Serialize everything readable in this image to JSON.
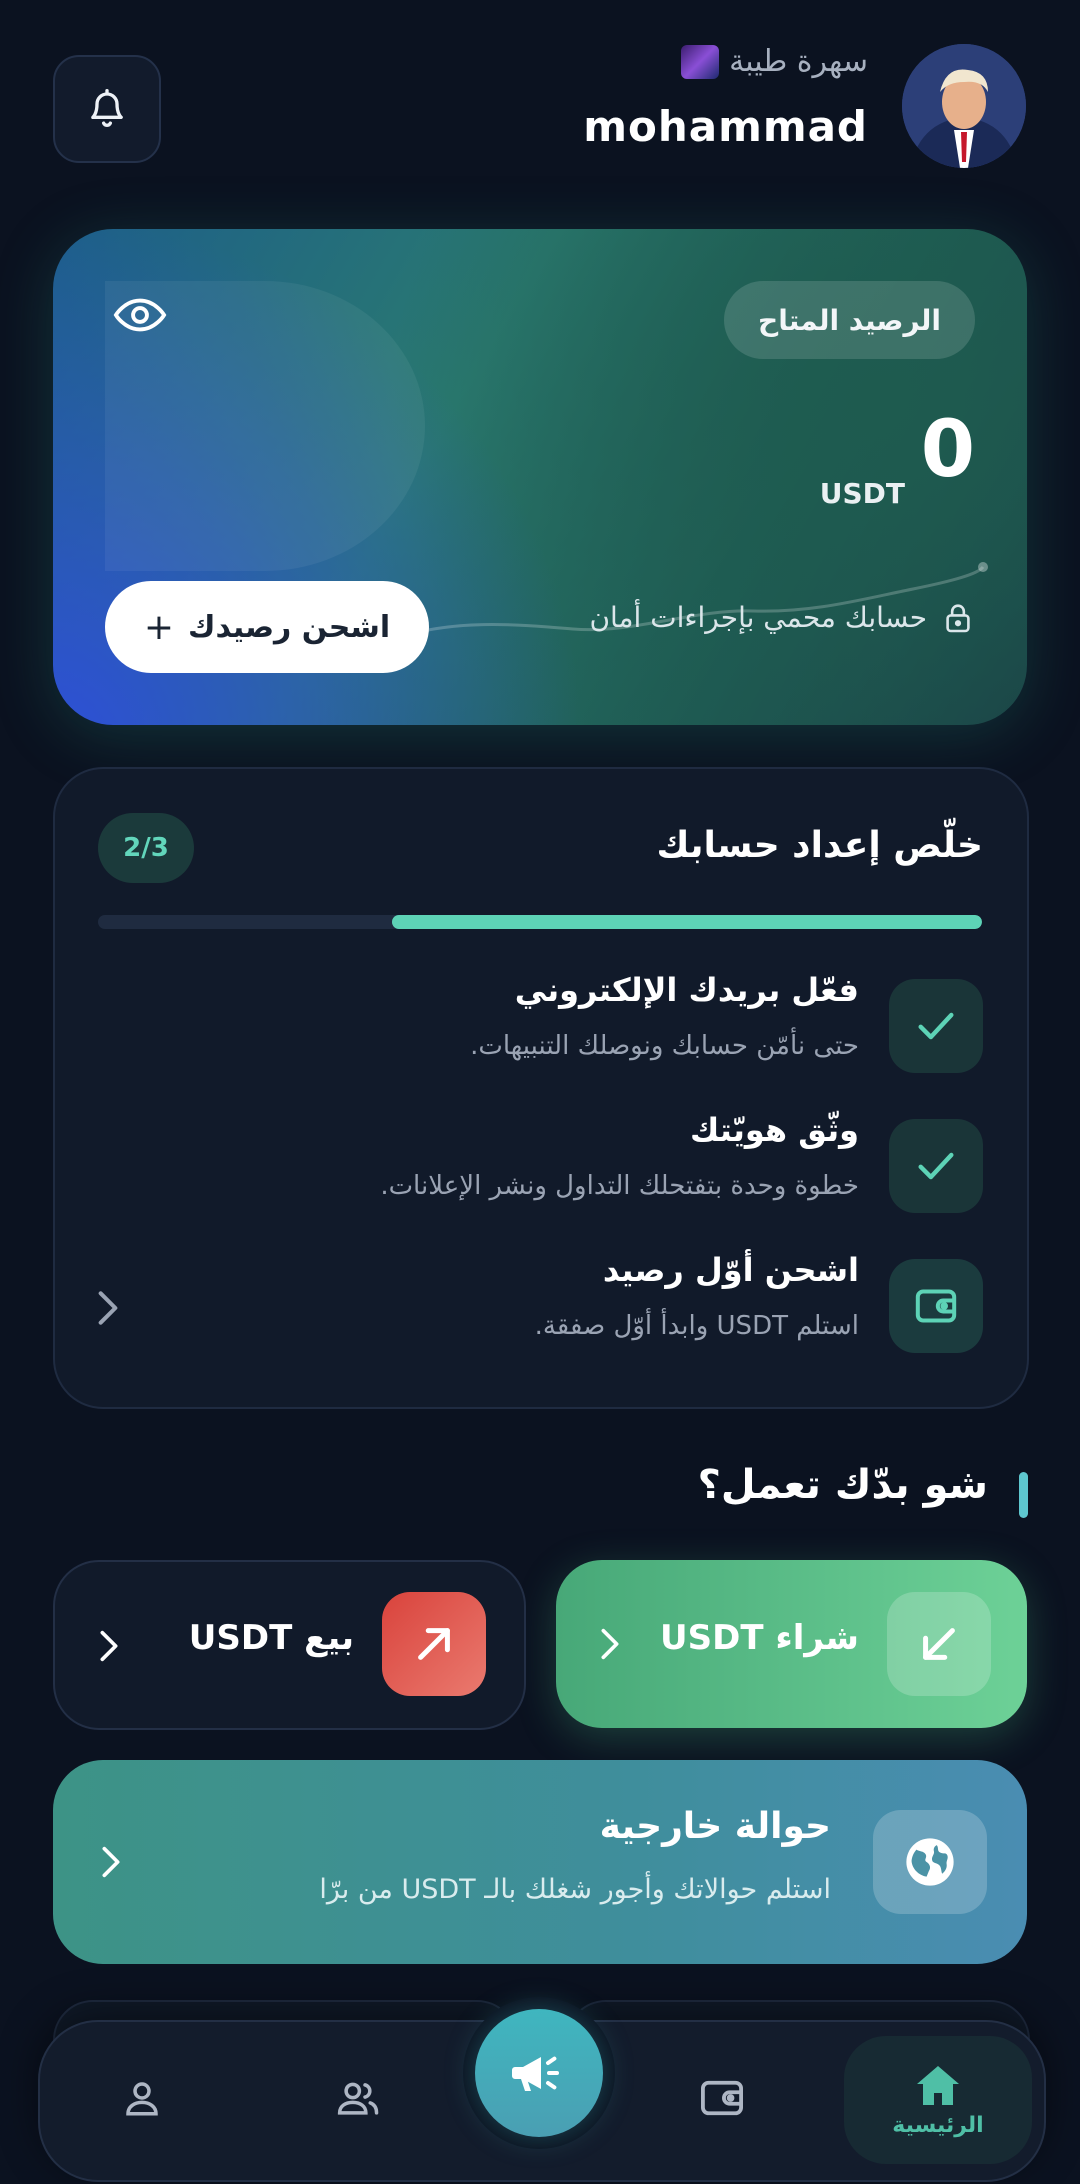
{
  "header": {
    "greeting": "سهرة طيبة",
    "username": "mohammad",
    "notification_icon": "bell-icon"
  },
  "balance": {
    "label": "الرصيد المتاح",
    "amount": "0",
    "currency": "USDT",
    "topup_label": "اشحن رصيدك",
    "topup_plus": "+",
    "secure_text": "حسابك محمي بإجراءات أمان"
  },
  "setup": {
    "title": "خلّص إعداد حسابك",
    "progress_text": "2/3",
    "progress_fraction": 0.667,
    "steps": [
      {
        "title": "فعّل بريدك الإلكتروني",
        "subtitle": "حتى نأمّن حسابك ونوصلك التنبيهات.",
        "done": true,
        "icon": "check-icon"
      },
      {
        "title": "وثّق هويّتك",
        "subtitle": "خطوة وحدة بتفتحلك التداول ونشر الإعلانات.",
        "done": true,
        "icon": "check-icon"
      },
      {
        "title": "اشحن أوّل رصيد",
        "subtitle": "استلم USDT وابدأ أوّل صفقة.",
        "done": false,
        "icon": "wallet-icon"
      }
    ]
  },
  "actions": {
    "section_title": "شو بدّك تعمل؟",
    "buy_label": "شراء USDT",
    "sell_label": "بيع USDT",
    "transfer_title": "حوالة خارجية",
    "transfer_subtitle": "استلم حوالاتك وأجور شغلك بالـ USDT من برّا"
  },
  "nav": {
    "home_label": "الرئيسية",
    "items": [
      "home-icon",
      "wallet-icon",
      "megaphone-icon",
      "users-icon",
      "profile-icon"
    ]
  },
  "colors": {
    "background": "#0b1220",
    "accent_teal": "#5dd3b6",
    "buy_green": "#5cc18a",
    "sell_red": "#e0574f"
  }
}
